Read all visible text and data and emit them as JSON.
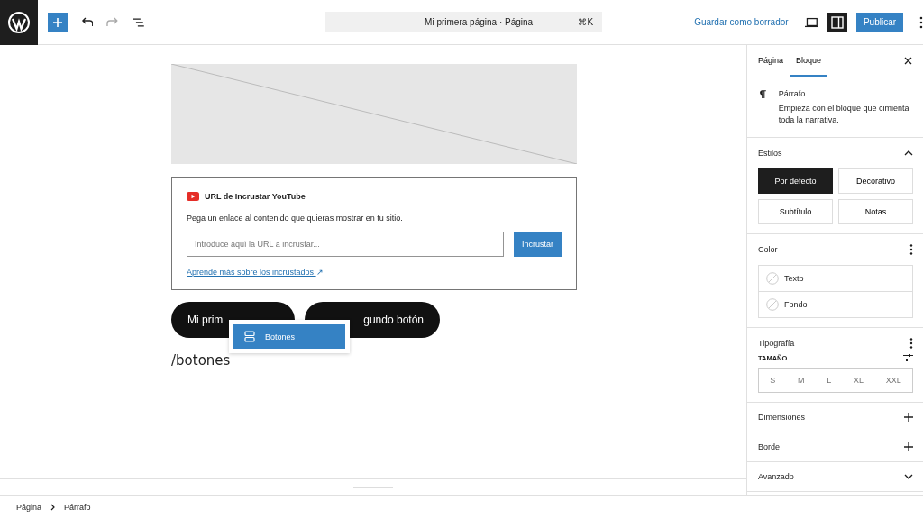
{
  "header": {
    "document_title": "Mi primera página · Página",
    "shortcut": "⌘K",
    "save_draft": "Guardar como borrador",
    "settings_panel_open": true,
    "publish": "Publicar"
  },
  "editor": {
    "embed": {
      "title": "URL de Incrustar YouTube",
      "description": "Pega un enlace al contenido que quieras mostrar en tu sitio.",
      "placeholder": "Introduce aquí la URL a incrustar...",
      "button": "Incrustar",
      "learn_more": "Aprende más sobre los incrustados",
      "learn_more_arrow": "↗"
    },
    "buttons": [
      "Mi prim",
      "gundo botón"
    ],
    "slash_text": "/botones",
    "suggestions": [
      {
        "label": "Botones",
        "selected": true
      }
    ]
  },
  "sidebar": {
    "tabs": [
      {
        "label": "Página",
        "selected": false
      },
      {
        "label": "Bloque",
        "selected": true
      }
    ],
    "block": {
      "name": "Párrafo",
      "description": "Empieza con el bloque que cimienta toda la narrativa."
    },
    "styles": {
      "title": "Estilos",
      "expanded": true,
      "options": [
        {
          "label": "Por defecto",
          "selected": true
        },
        {
          "label": "Decorativo",
          "selected": false
        },
        {
          "label": "Subtítulo",
          "selected": false
        },
        {
          "label": "Notas",
          "selected": false
        }
      ]
    },
    "color": {
      "title": "Color",
      "items": [
        "Texto",
        "Fondo"
      ]
    },
    "typography": {
      "title": "Tipografía",
      "size_label": "TAMAÑO",
      "sizes": [
        "S",
        "M",
        "L",
        "XL",
        "XXL"
      ]
    },
    "panels": [
      {
        "title": "Dimensiones",
        "kind": "add"
      },
      {
        "title": "Borde",
        "kind": "add"
      },
      {
        "title": "Avanzado",
        "kind": "expand"
      }
    ]
  },
  "breadcrumb": [
    "Página",
    "Párrafo"
  ]
}
